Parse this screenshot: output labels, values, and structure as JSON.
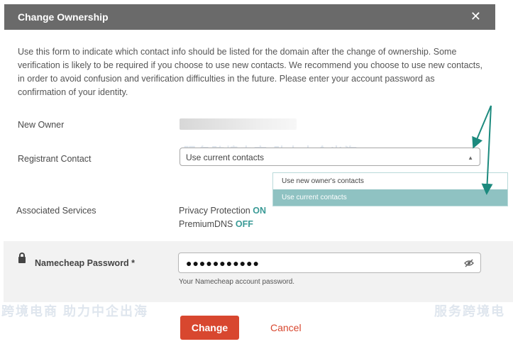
{
  "dialog": {
    "title": "Change Ownership",
    "close_glyph": "✕",
    "description": "Use this form to indicate which contact info should be listed for the domain after the change of ownership. Some verification is likely to be required if you choose to use new contacts. We recommend you choose to use new contacts, in order to avoid confusion and verification difficulties in the future. Please enter your account password as confirmation of your identity."
  },
  "form": {
    "new_owner_label": "New Owner",
    "registrant_label": "Registrant Contact",
    "registrant_value": "Use current contacts",
    "registrant_options": [
      "Use new owner's contacts",
      "Use current contacts"
    ],
    "associated_label": "Associated Services",
    "privacy_label": "Privacy Protection",
    "privacy_status": "ON",
    "premiumdns_label": "PremiumDNS",
    "premiumdns_status": "OFF",
    "password_label": "Namecheap Password *",
    "password_mask": "●●●●●●●●●●●",
    "password_hint": "Your Namecheap account password."
  },
  "buttons": {
    "change": "Change",
    "cancel": "Cancel"
  },
  "watermark": {
    "text1": "服务跨境电商 助力中企出海",
    "text2": "跨境电商 助力中企出海",
    "text3": "服务跨境电"
  },
  "colors": {
    "titlebar": "#6a6a6a",
    "accent_teal": "#3a9a96",
    "button_red": "#d8472f",
    "arrow": "#1c8a7e"
  }
}
